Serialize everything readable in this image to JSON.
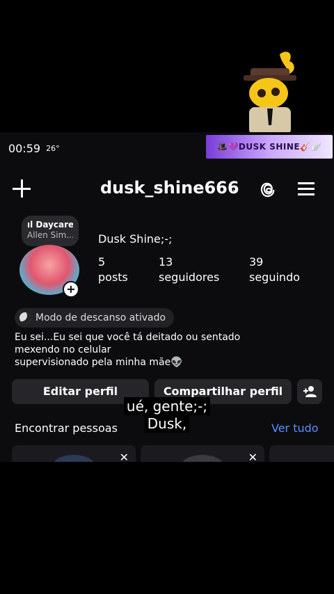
{
  "status": {
    "time": "00:59",
    "temp": "26°"
  },
  "banner": {
    "text": "🎩💜DUSK SHINE🎸🪽"
  },
  "header": {
    "username": "dusk_shine666"
  },
  "note": {
    "line1": "ıl Daycare",
    "line2": "Allen Sim..."
  },
  "profile": {
    "display_name": "Dusk Shine;-;",
    "stats": [
      {
        "value": "5",
        "label": "posts"
      },
      {
        "value": "13",
        "label": "seguidores"
      },
      {
        "value": "39",
        "label": "seguindo"
      }
    ],
    "rest_mode": "Modo de descanso ativado",
    "bio": [
      "Eu sei...Eu sei que você tá deitado ou sentado",
      "mexendo no celular",
      "supervisionado pela minha mãe👽"
    ]
  },
  "actions": {
    "edit": "Editar perfil",
    "share": "Compartilhar perfil"
  },
  "suggestions": {
    "title": "Encontrar pessoas",
    "see_all": "Ver tudo"
  },
  "captions": {
    "line1": "ué, gente;-;",
    "line2": "Dusk,"
  },
  "icons": [
    "plus-icon",
    "chevron-down-icon",
    "threads-icon",
    "menu-icon",
    "add-story-icon",
    "moon-icon",
    "add-person-icon",
    "close-icon"
  ]
}
